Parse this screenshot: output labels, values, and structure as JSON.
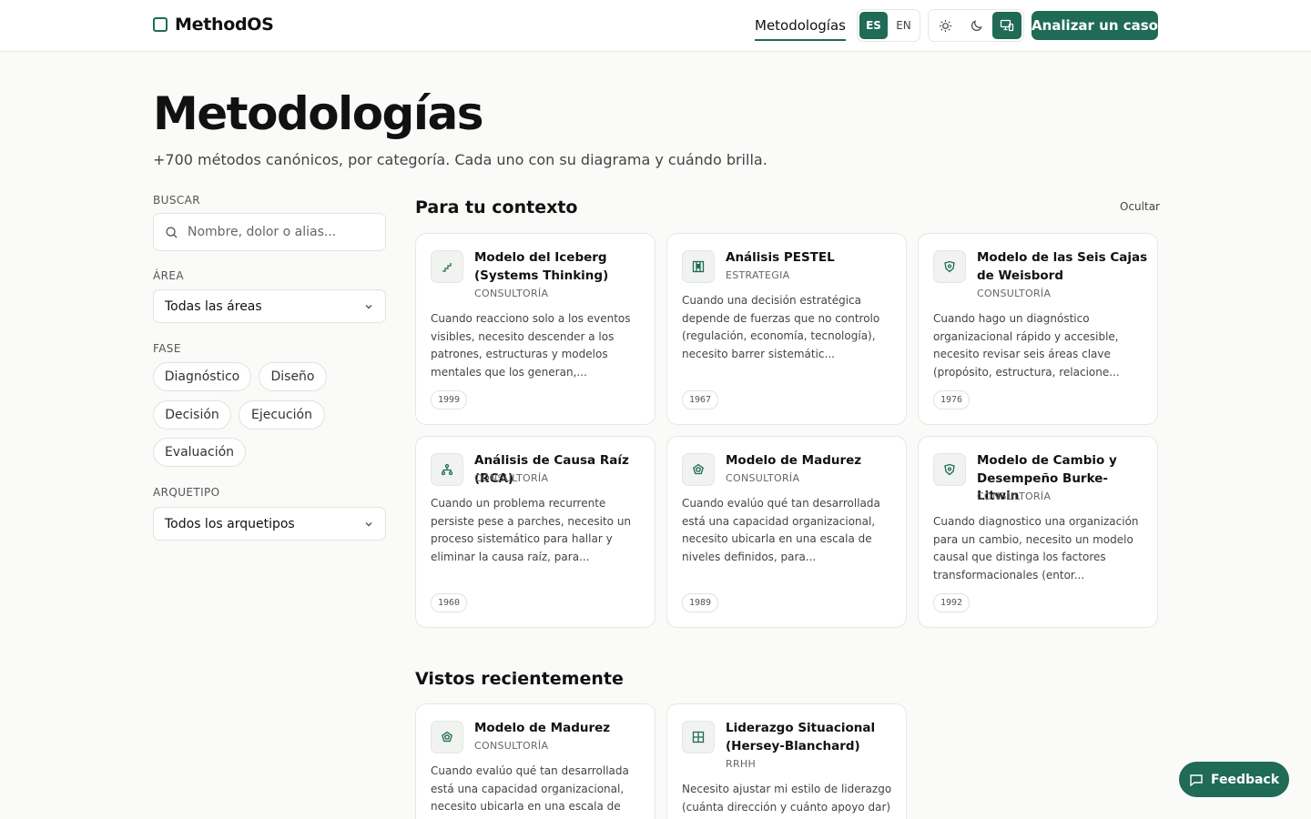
{
  "header": {
    "brand": "MethodOS",
    "nav_link": "Metodologías",
    "languages": [
      "ES",
      "EN"
    ],
    "active_language": "ES",
    "theme_modes": [
      "light",
      "dark",
      "system"
    ],
    "active_theme": "system",
    "cta_label": "Analizar un caso"
  },
  "hero": {
    "title": "Metodologías",
    "subtitle": "+700 métodos canónicos, por categoría. Cada uno con su diagrama y cuándo brilla."
  },
  "filters": {
    "search_label": "BUSCAR",
    "search_placeholder": "Nombre, dolor o alias...",
    "area_label": "ÁREA",
    "area_value": "Todas las áreas",
    "phase_label": "FASE",
    "phases": [
      "Diagnóstico",
      "Diseño",
      "Decisión",
      "Ejecución",
      "Evaluación"
    ],
    "archetype_label": "ARQUETIPO",
    "archetype_value": "Todos los arquetipos"
  },
  "context_section": {
    "title": "Para tu contexto",
    "hide_label": "Ocultar",
    "cards": [
      {
        "title": "Modelo del Iceberg (Systems Thinking)",
        "category": "CONSULTORÍA",
        "description": "Cuando reacciono solo a los eventos visibles, necesito descender a los patrones, estructuras y modelos mentales que los generan,...",
        "year": "1999",
        "icon": "stairs-icon"
      },
      {
        "title": "Análisis PESTEL",
        "category": "ESTRATEGIA",
        "description": "Cuando una decisión estratégica depende de fuerzas que no controlo (regulación, economía, tecnología), necesito barrer sistemátic...",
        "year": "1967",
        "icon": "columns-icon"
      },
      {
        "title": "Modelo de las Seis Cajas de Weisbord",
        "category": "CONSULTORÍA",
        "description": "Cuando hago un diagnóstico organizacional rápido y accesible, necesito revisar seis áreas clave (propósito, estructura, relacione...",
        "year": "1976",
        "icon": "shield-icon"
      },
      {
        "title": "Análisis de Causa Raíz (RCA)",
        "category": "CONSULTORÍA",
        "description": "Cuando un problema recurrente persiste pese a parches, necesito un proceso sistemático para hallar y eliminar la causa raíz, para...",
        "year": "1960",
        "icon": "tree-icon"
      },
      {
        "title": "Modelo de Madurez",
        "category": "CONSULTORÍA",
        "description": "Cuando evalúo qué tan desarrollada está una capacidad organizacional, necesito ubicarla en una escala de niveles definidos, para...",
        "year": "1989",
        "icon": "pentagon-icon"
      },
      {
        "title": "Modelo de Cambio y Desempeño Burke-Litwin",
        "category": "CONSULTORÍA",
        "description": "Cuando diagnostico una organización para un cambio, necesito un modelo causal que distinga los factores transformacionales (entor...",
        "year": "1992",
        "icon": "shield-icon"
      }
    ]
  },
  "recent_section": {
    "title": "Vistos recientemente",
    "cards": [
      {
        "title": "Modelo de Madurez",
        "category": "CONSULTORÍA",
        "description": "Cuando evalúo qué tan desarrollada está una capacidad organizacional, necesito ubicarla en una escala de",
        "icon": "pentagon-icon"
      },
      {
        "title": "Liderazgo Situacional (Hersey-Blanchard)",
        "category": "RRHH",
        "description": "Necesito ajustar mi estilo de liderazgo (cuánta dirección y cuánto apoyo dar) al",
        "icon": "grid-icon"
      }
    ]
  },
  "feedback_label": "Feedback",
  "colors": {
    "accent": "#1f6b55",
    "background": "#fafaf9",
    "card": "#ffffff",
    "border": "#e7e7e4"
  }
}
